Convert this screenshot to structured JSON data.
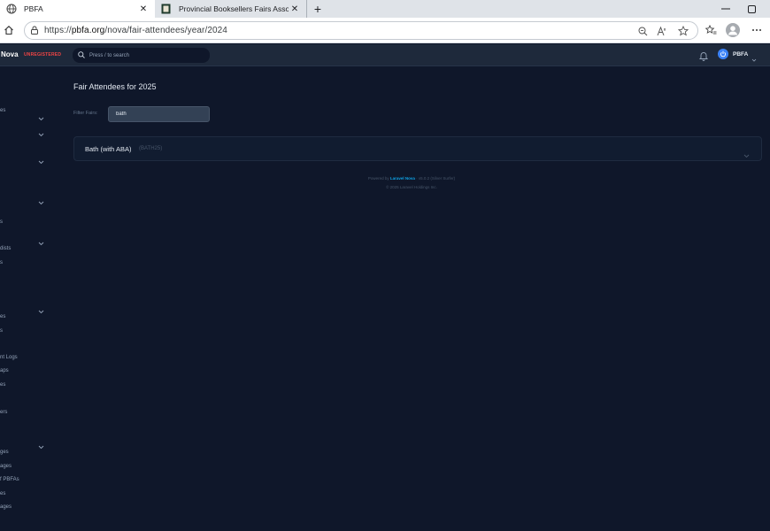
{
  "browser": {
    "tabs": [
      {
        "title": "PBFA",
        "active": true
      },
      {
        "title": "Provincial Booksellers Fairs Assoc",
        "active": false
      }
    ],
    "new_tab": "+",
    "url_prefix": "https://",
    "url_host": "pbfa.org",
    "url_path": "/nova/fair-attendees/year/2024"
  },
  "header": {
    "brand": "Nova",
    "env_badge": "UNREGISTERED",
    "search_placeholder": "Press / to search",
    "user_name": "PBFA"
  },
  "sidebar": {
    "items": [
      {
        "label": "es",
        "chevron": true
      },
      {
        "label": "",
        "chevron": true
      },
      {
        "label": "",
        "chevron": true
      },
      {
        "label": "",
        "chevron": true
      },
      {
        "label": "s",
        "chevron": false
      },
      {
        "label": "",
        "chevron": true
      },
      {
        "label": "dists",
        "chevron": false
      },
      {
        "label": "s",
        "chevron": false
      },
      {
        "label": "",
        "chevron": true
      },
      {
        "label": "es",
        "chevron": false
      },
      {
        "label": "s",
        "chevron": false
      },
      {
        "label": "nt Logs",
        "chevron": false
      },
      {
        "label": "aps",
        "chevron": false
      },
      {
        "label": "es",
        "chevron": false
      },
      {
        "label": "ers",
        "chevron": false
      },
      {
        "label": "",
        "chevron": true
      },
      {
        "label": "ges",
        "chevron": false
      },
      {
        "label": "ages",
        "chevron": false
      },
      {
        "label": "f PBFAs",
        "chevron": false
      },
      {
        "label": "es",
        "chevron": false
      },
      {
        "label": "ages",
        "chevron": false
      }
    ]
  },
  "main": {
    "title": "Fair Attendees for 2025",
    "filter_label": "Filter Fairs:",
    "filter_value": "bath",
    "results": [
      {
        "title": "Bath (with ABA)",
        "code": "(BATH25)"
      }
    ],
    "footer": {
      "powered_by": "Powered by",
      "product": "Laravel Nova",
      "version": "· v5.0.2 (Silver Surfer)",
      "copyright": "© 2025 Laravel Holdings Inc."
    }
  },
  "colors": {
    "background": "#0f172a",
    "header": "#1e293b",
    "accent": "#0ea5e9",
    "badge": "#ef4444"
  }
}
